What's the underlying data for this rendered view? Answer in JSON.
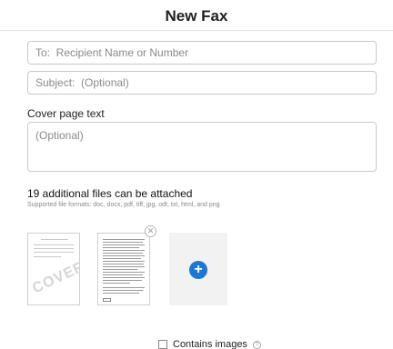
{
  "header": {
    "title": "New Fax"
  },
  "to": {
    "placeholder": "To:  Recipient Name or Number",
    "value": ""
  },
  "subject": {
    "placeholder": "Subject:  (Optional)",
    "value": ""
  },
  "cover_page": {
    "label": "Cover page text",
    "placeholder": "(Optional)"
  },
  "attachments": {
    "heading": "19 additional files can be attached",
    "formats": "Supported file formats: doc, docx, pdf, tiff, jpg, odt, txt, html, and png",
    "cover_thumbnail_text": "COVER",
    "remove_icon": "close-icon",
    "add_icon": "plus-icon"
  },
  "contains_images": {
    "label": "Contains images",
    "checked": false,
    "help_icon": "question-icon"
  },
  "colors": {
    "accent": "#1e78d2",
    "border": "#c9c9c9",
    "muted_text": "#8a8a8a"
  }
}
